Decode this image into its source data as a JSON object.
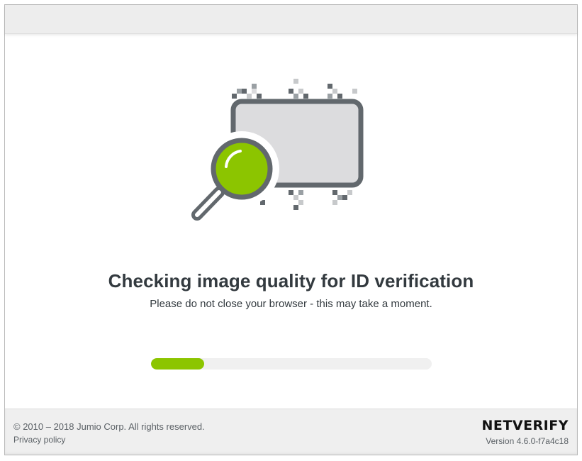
{
  "illustration": {
    "icon": "magnifier-over-id-card-icon",
    "accent": "#8cc500",
    "outline": "#62686d",
    "card_fill": "#dcdcde"
  },
  "status": {
    "title": "Checking image quality for ID verification",
    "subtitle": "Please do not close your browser - this may take a moment.",
    "progress": 0.19,
    "progress_color": "#8cc500"
  },
  "footer": {
    "copyright": "© 2010 – 2018 Jumio Corp. All rights reserved.",
    "privacy_label": "Privacy policy",
    "brand": "NETVERIFY",
    "version": "Version 4.6.0-f7a4c18"
  }
}
